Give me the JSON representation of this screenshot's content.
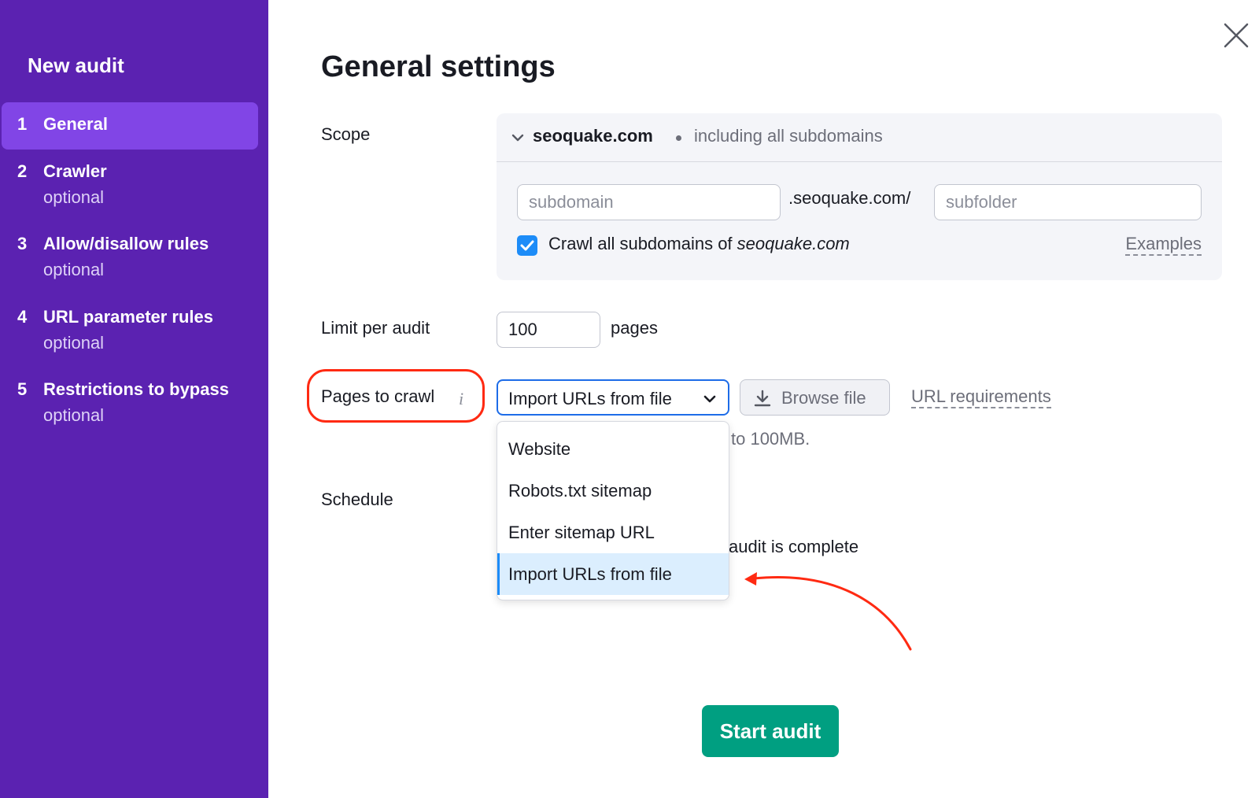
{
  "sidebar": {
    "title": "New audit",
    "steps": [
      {
        "num": "1",
        "label": "General",
        "sub": ""
      },
      {
        "num": "2",
        "label": "Crawler",
        "sub": "optional"
      },
      {
        "num": "3",
        "label": "Allow/disallow rules",
        "sub": "optional"
      },
      {
        "num": "4",
        "label": "URL parameter rules",
        "sub": "optional"
      },
      {
        "num": "5",
        "label": "Restrictions to bypass",
        "sub": "optional"
      }
    ]
  },
  "main": {
    "title": "General settings",
    "scope": {
      "label": "Scope",
      "domain": "seoquake.com",
      "note": "including all subdomains",
      "subdomain_placeholder": "subdomain",
      "suffix": ".seoquake.com/",
      "subfolder_placeholder": "subfolder",
      "checkbox_prefix": "Crawl all subdomains of ",
      "checkbox_domain": "seoquake.com",
      "checkbox_checked": true,
      "examples_link": "Examples"
    },
    "limit": {
      "label": "Limit per audit",
      "value": "100",
      "unit": "pages"
    },
    "pages_to_crawl": {
      "label": "Pages to crawl",
      "info_glyph": "i",
      "selected": "Import URLs from file",
      "browse_label": "Browse file",
      "requirements_link": "URL requirements",
      "hint_visible": "to 100MB.",
      "options": [
        "Website",
        "Robots.txt sitemap",
        "Enter sitemap URL",
        "Import URLs from file"
      ],
      "selected_index": 3
    },
    "schedule": {
      "label": "Schedule",
      "visible_text": "audit is complete"
    },
    "start_button": "Start audit"
  },
  "colors": {
    "sidebar_bg": "#5b22b1",
    "sidebar_active": "#8145e6",
    "primary_button": "#009f81",
    "accent_blue": "#1d8cf8",
    "annotation_red": "#ff2a12"
  }
}
